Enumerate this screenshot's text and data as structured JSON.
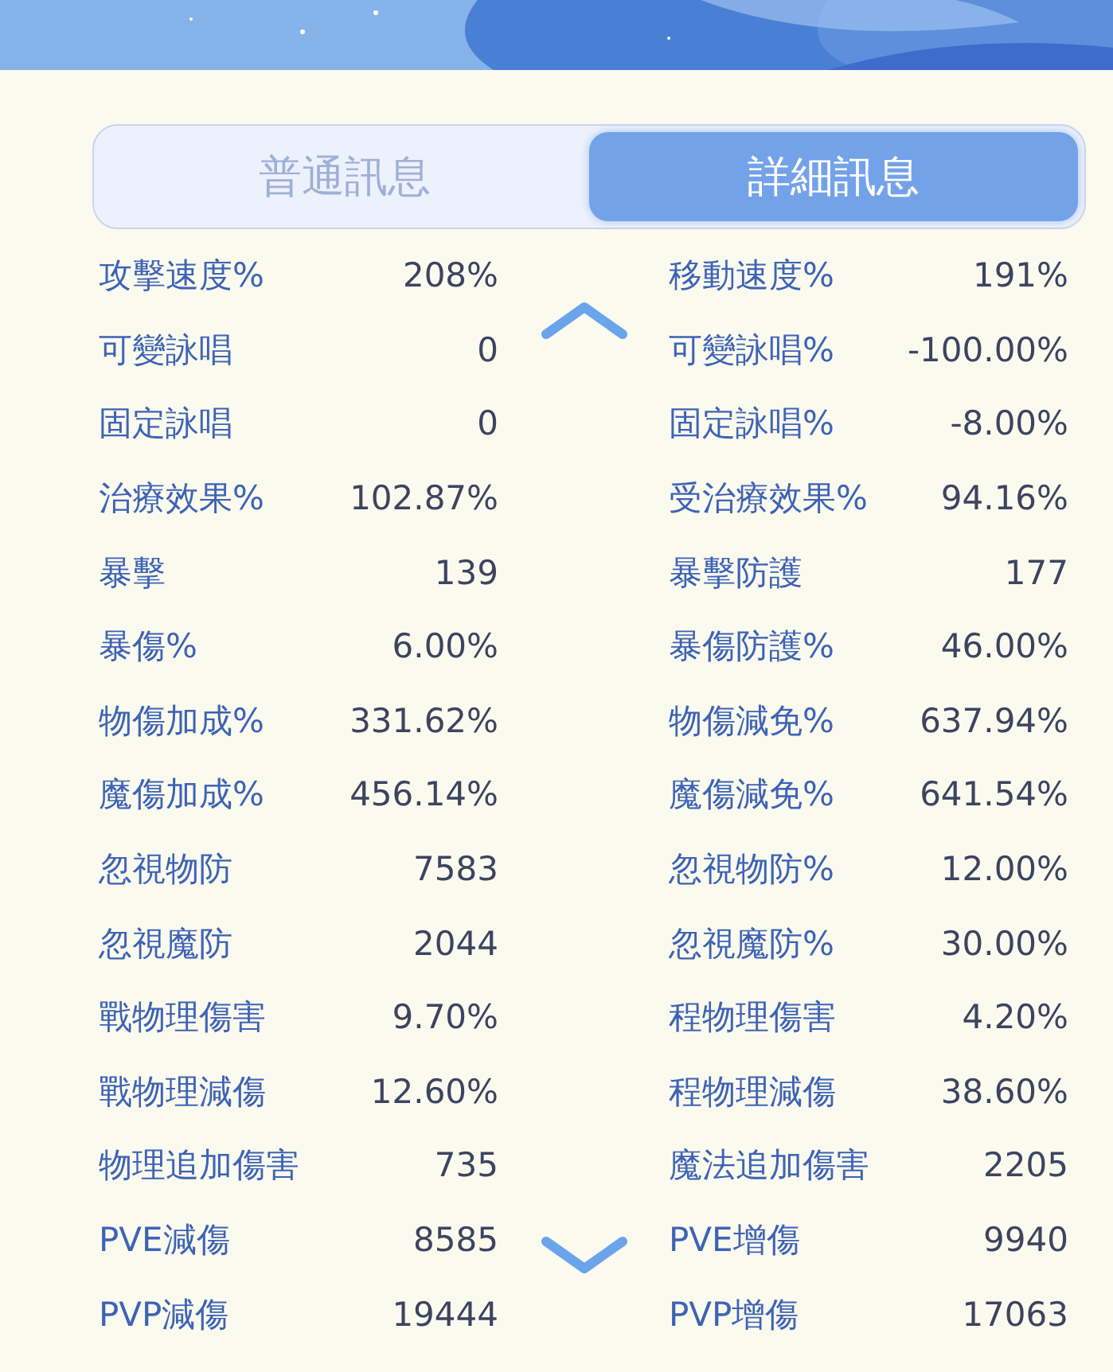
{
  "tabs": [
    {
      "label": "普通訊息",
      "selected": false
    },
    {
      "label": "詳細訊息",
      "selected": true
    }
  ],
  "stats_left": [
    {
      "label": "攻擊速度%",
      "value": "208%"
    },
    {
      "label": "可變詠唱",
      "value": "0"
    },
    {
      "label": "固定詠唱",
      "value": "0"
    },
    {
      "label": "治療效果%",
      "value": "102.87%"
    },
    {
      "label": "暴擊",
      "value": "139"
    },
    {
      "label": "暴傷%",
      "value": "6.00%"
    },
    {
      "label": "物傷加成%",
      "value": "331.62%"
    },
    {
      "label": "魔傷加成%",
      "value": "456.14%"
    },
    {
      "label": "忽視物防",
      "value": "7583"
    },
    {
      "label": "忽視魔防",
      "value": "2044"
    },
    {
      "label": "戰物理傷害",
      "value": "9.70%"
    },
    {
      "label": "戰物理減傷",
      "value": "12.60%"
    },
    {
      "label": "物理追加傷害",
      "value": "735"
    },
    {
      "label": "PVE減傷",
      "value": "8585"
    },
    {
      "label": "PVP減傷",
      "value": "19444"
    }
  ],
  "stats_right": [
    {
      "label": "移動速度%",
      "value": "191%"
    },
    {
      "label": "可變詠唱%",
      "value": "-100.00%"
    },
    {
      "label": "固定詠唱%",
      "value": "-8.00%"
    },
    {
      "label": "受治療效果%",
      "value": "94.16%"
    },
    {
      "label": "暴擊防護",
      "value": "177"
    },
    {
      "label": "暴傷防護%",
      "value": "46.00%"
    },
    {
      "label": "物傷減免%",
      "value": "637.94%"
    },
    {
      "label": "魔傷減免%",
      "value": "641.54%"
    },
    {
      "label": "忽視物防%",
      "value": "12.00%"
    },
    {
      "label": "忽視魔防%",
      "value": "30.00%"
    },
    {
      "label": "程物理傷害",
      "value": "4.20%"
    },
    {
      "label": "程物理減傷",
      "value": "38.60%"
    },
    {
      "label": "魔法追加傷害",
      "value": "2205"
    },
    {
      "label": "PVE增傷",
      "value": "9940"
    },
    {
      "label": "PVP增傷",
      "value": "17063"
    }
  ]
}
